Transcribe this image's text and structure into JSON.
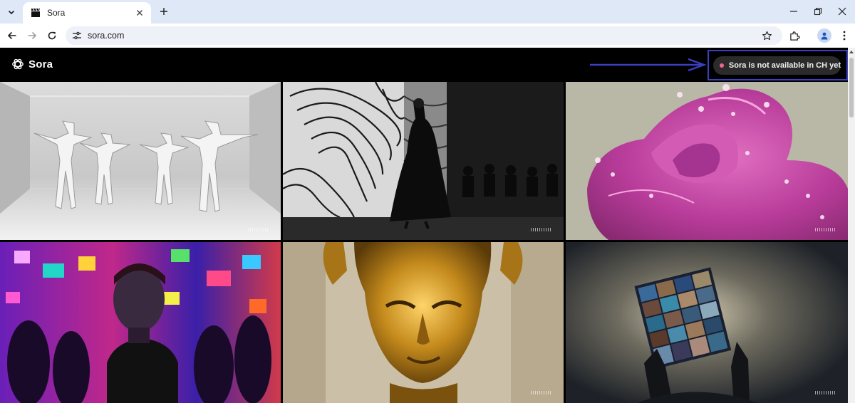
{
  "browser": {
    "tab_title": "Sora",
    "url": "sora.com",
    "icons": {
      "tab_search": "chevron-down-icon",
      "favicon": "clapperboard-icon",
      "close": "close-icon",
      "new_tab": "plus-icon",
      "back": "back-arrow-icon",
      "forward": "forward-arrow-icon",
      "reload": "reload-icon",
      "site_info": "tune-icon",
      "bookmark": "star-icon",
      "extensions": "puzzle-icon",
      "profile": "person-icon",
      "menu": "kebab-menu-icon"
    }
  },
  "header": {
    "logo_text": "Sora",
    "notice_text": "Sora is not available in CH yet",
    "notice_dot_color": "#f2668b",
    "annotation_color": "#3b3fc0"
  },
  "gallery": {
    "tiles": [
      {
        "subject": "origami-dancers"
      },
      {
        "subject": "runway-model"
      },
      {
        "subject": "pink-rose-droplets"
      },
      {
        "subject": "neon-club-crowd"
      },
      {
        "subject": "golden-statue-face"
      },
      {
        "subject": "photo-collage-frame"
      }
    ]
  }
}
